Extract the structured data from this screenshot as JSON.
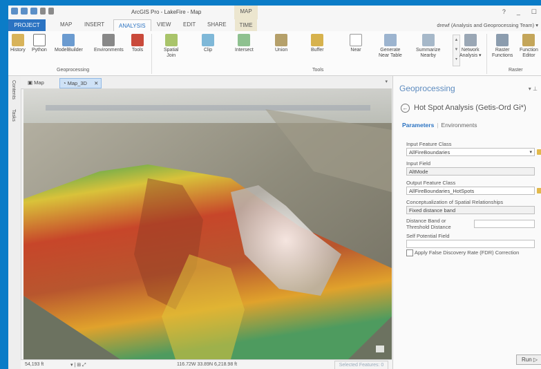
{
  "titlebar": {
    "title": "ArcGIS Pro - LakeFire - Map",
    "context_tab": "MAP",
    "help": "?",
    "minimize": "_",
    "maximize": "☐"
  },
  "tabs": {
    "project": "PROJECT",
    "map": "MAP",
    "insert": "INSERT",
    "analysis": "ANALYSIS",
    "view": "VIEW",
    "edit": "EDIT",
    "share": "SHARE",
    "time": "TIME"
  },
  "user": "drewf (Analysis and Geoprocessing Team) ▾",
  "ribbon": {
    "geoprocessing": {
      "label": "Geoprocessing",
      "buttons": [
        "History",
        "Python",
        "ModelBuilder",
        "Environments",
        "Tools"
      ]
    },
    "tools": {
      "label": "Tools",
      "buttons": [
        {
          "line1": "Spatial",
          "line2": "Join"
        },
        {
          "line1": "Clip",
          "line2": ""
        },
        {
          "line1": "Intersect",
          "line2": ""
        },
        {
          "line1": "Union",
          "line2": ""
        },
        {
          "line1": "Buffer",
          "line2": ""
        },
        {
          "line1": "Near",
          "line2": ""
        },
        {
          "line1": "Generate",
          "line2": "Near Table"
        },
        {
          "line1": "Summarize",
          "line2": "Nearby"
        }
      ]
    },
    "network": {
      "line1": "Network",
      "line2": "Analysis ▾"
    },
    "raster": {
      "label": "Raster",
      "buttons": [
        {
          "line1": "Raster",
          "line2": "Functions"
        },
        {
          "line1": "Function",
          "line2": "Editor"
        }
      ]
    }
  },
  "side_tabs": [
    "Contents",
    "Tasks"
  ],
  "map_tabs": {
    "tab1": "Map",
    "tab2": "Map_3D",
    "close": "✕",
    "pin": "▾"
  },
  "statusbar": {
    "scale": "54,193 ft",
    "coords": "116.72W 33.89N  6,218.98 ft",
    "selected": "Selected Features: 0"
  },
  "geoprocessing": {
    "title": "Geoprocessing",
    "pin": "▾ ⊥",
    "tool": "Hot Spot Analysis (Getis-Ord Gi*)",
    "subtab_on": "Parameters",
    "subtab_off": "Environments",
    "params": {
      "input_fc_label": "Input Feature Class",
      "input_fc_value": "AllFireBoundaries",
      "input_field_label": "Input Field",
      "input_field_value": "AltMode",
      "output_fc_label": "Output Feature Class",
      "output_fc_value": "AllFireBoundaries_HotSpots",
      "concept_label": "Conceptualization of Spatial Relationships",
      "concept_value": "Fixed distance band",
      "distance_label_1": "Distance Band or",
      "distance_label_2": "Threshold Distance",
      "distance_value": "",
      "self_potential_label": "Self Potential Field",
      "self_potential_value": "",
      "fdr_label": "Apply False Discovery Rate (FDR) Correction"
    },
    "run": "Run ▷"
  },
  "colors": {
    "accent": "#2b73c2",
    "frame": "#0b7cc7",
    "gp_title": "#5d8bbf"
  }
}
